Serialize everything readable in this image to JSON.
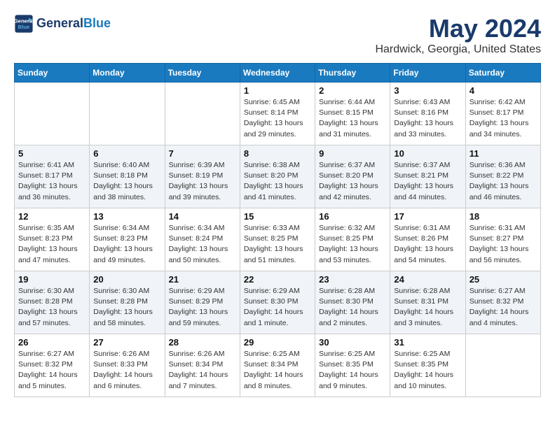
{
  "header": {
    "logo_line1": "General",
    "logo_line2": "Blue",
    "title": "May 2024",
    "subtitle": "Hardwick, Georgia, United States"
  },
  "days_of_week": [
    "Sunday",
    "Monday",
    "Tuesday",
    "Wednesday",
    "Thursday",
    "Friday",
    "Saturday"
  ],
  "weeks": [
    [
      {
        "day": "",
        "info": ""
      },
      {
        "day": "",
        "info": ""
      },
      {
        "day": "",
        "info": ""
      },
      {
        "day": "1",
        "info": "Sunrise: 6:45 AM\nSunset: 8:14 PM\nDaylight: 13 hours and 29 minutes."
      },
      {
        "day": "2",
        "info": "Sunrise: 6:44 AM\nSunset: 8:15 PM\nDaylight: 13 hours and 31 minutes."
      },
      {
        "day": "3",
        "info": "Sunrise: 6:43 AM\nSunset: 8:16 PM\nDaylight: 13 hours and 33 minutes."
      },
      {
        "day": "4",
        "info": "Sunrise: 6:42 AM\nSunset: 8:17 PM\nDaylight: 13 hours and 34 minutes."
      }
    ],
    [
      {
        "day": "5",
        "info": "Sunrise: 6:41 AM\nSunset: 8:17 PM\nDaylight: 13 hours and 36 minutes."
      },
      {
        "day": "6",
        "info": "Sunrise: 6:40 AM\nSunset: 8:18 PM\nDaylight: 13 hours and 38 minutes."
      },
      {
        "day": "7",
        "info": "Sunrise: 6:39 AM\nSunset: 8:19 PM\nDaylight: 13 hours and 39 minutes."
      },
      {
        "day": "8",
        "info": "Sunrise: 6:38 AM\nSunset: 8:20 PM\nDaylight: 13 hours and 41 minutes."
      },
      {
        "day": "9",
        "info": "Sunrise: 6:37 AM\nSunset: 8:20 PM\nDaylight: 13 hours and 42 minutes."
      },
      {
        "day": "10",
        "info": "Sunrise: 6:37 AM\nSunset: 8:21 PM\nDaylight: 13 hours and 44 minutes."
      },
      {
        "day": "11",
        "info": "Sunrise: 6:36 AM\nSunset: 8:22 PM\nDaylight: 13 hours and 46 minutes."
      }
    ],
    [
      {
        "day": "12",
        "info": "Sunrise: 6:35 AM\nSunset: 8:23 PM\nDaylight: 13 hours and 47 minutes."
      },
      {
        "day": "13",
        "info": "Sunrise: 6:34 AM\nSunset: 8:23 PM\nDaylight: 13 hours and 49 minutes."
      },
      {
        "day": "14",
        "info": "Sunrise: 6:34 AM\nSunset: 8:24 PM\nDaylight: 13 hours and 50 minutes."
      },
      {
        "day": "15",
        "info": "Sunrise: 6:33 AM\nSunset: 8:25 PM\nDaylight: 13 hours and 51 minutes."
      },
      {
        "day": "16",
        "info": "Sunrise: 6:32 AM\nSunset: 8:25 PM\nDaylight: 13 hours and 53 minutes."
      },
      {
        "day": "17",
        "info": "Sunrise: 6:31 AM\nSunset: 8:26 PM\nDaylight: 13 hours and 54 minutes."
      },
      {
        "day": "18",
        "info": "Sunrise: 6:31 AM\nSunset: 8:27 PM\nDaylight: 13 hours and 56 minutes."
      }
    ],
    [
      {
        "day": "19",
        "info": "Sunrise: 6:30 AM\nSunset: 8:28 PM\nDaylight: 13 hours and 57 minutes."
      },
      {
        "day": "20",
        "info": "Sunrise: 6:30 AM\nSunset: 8:28 PM\nDaylight: 13 hours and 58 minutes."
      },
      {
        "day": "21",
        "info": "Sunrise: 6:29 AM\nSunset: 8:29 PM\nDaylight: 13 hours and 59 minutes."
      },
      {
        "day": "22",
        "info": "Sunrise: 6:29 AM\nSunset: 8:30 PM\nDaylight: 14 hours and 1 minute."
      },
      {
        "day": "23",
        "info": "Sunrise: 6:28 AM\nSunset: 8:30 PM\nDaylight: 14 hours and 2 minutes."
      },
      {
        "day": "24",
        "info": "Sunrise: 6:28 AM\nSunset: 8:31 PM\nDaylight: 14 hours and 3 minutes."
      },
      {
        "day": "25",
        "info": "Sunrise: 6:27 AM\nSunset: 8:32 PM\nDaylight: 14 hours and 4 minutes."
      }
    ],
    [
      {
        "day": "26",
        "info": "Sunrise: 6:27 AM\nSunset: 8:32 PM\nDaylight: 14 hours and 5 minutes."
      },
      {
        "day": "27",
        "info": "Sunrise: 6:26 AM\nSunset: 8:33 PM\nDaylight: 14 hours and 6 minutes."
      },
      {
        "day": "28",
        "info": "Sunrise: 6:26 AM\nSunset: 8:34 PM\nDaylight: 14 hours and 7 minutes."
      },
      {
        "day": "29",
        "info": "Sunrise: 6:25 AM\nSunset: 8:34 PM\nDaylight: 14 hours and 8 minutes."
      },
      {
        "day": "30",
        "info": "Sunrise: 6:25 AM\nSunset: 8:35 PM\nDaylight: 14 hours and 9 minutes."
      },
      {
        "day": "31",
        "info": "Sunrise: 6:25 AM\nSunset: 8:35 PM\nDaylight: 14 hours and 10 minutes."
      },
      {
        "day": "",
        "info": ""
      }
    ]
  ]
}
